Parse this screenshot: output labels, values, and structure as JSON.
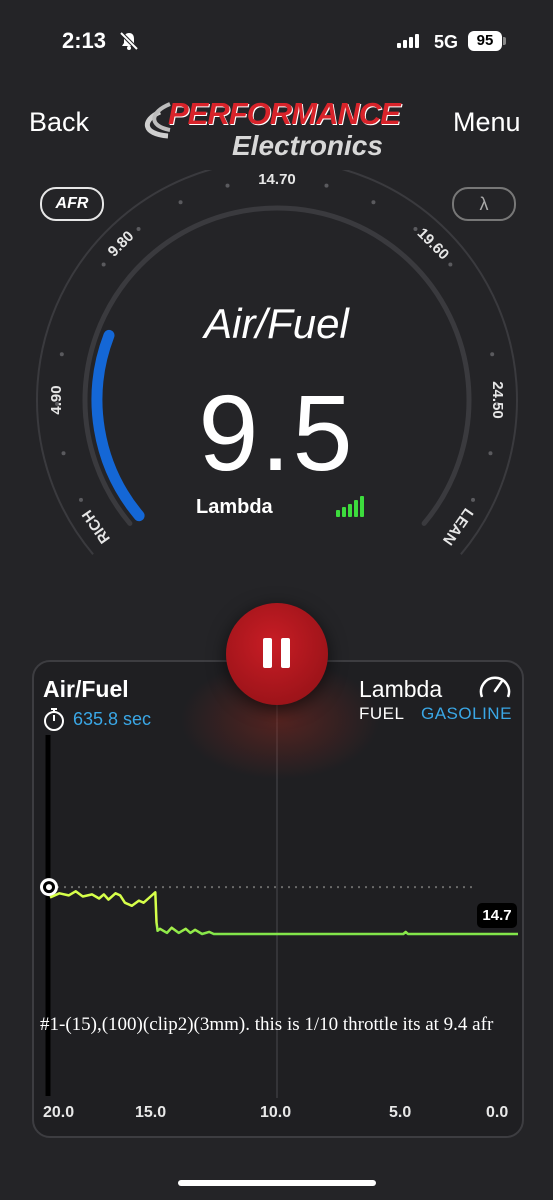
{
  "status": {
    "time": "2:13",
    "network": "5G",
    "battery": "95"
  },
  "nav": {
    "back": "Back",
    "menu": "Menu"
  },
  "logo": {
    "line1": "PERFORMANCE",
    "line2": "Electronics"
  },
  "mode": {
    "afr": "AFR",
    "lambda": "λ"
  },
  "gauge": {
    "title": "Air/Fuel",
    "value": "9.5",
    "unit_label": "Lambda",
    "scale": [
      "4.90",
      "9.80",
      "14.70",
      "19.60",
      "24.50"
    ],
    "rich_label": "RICH",
    "lean_label": "LEAN",
    "level": 9.5,
    "range": [
      4.9,
      24.5
    ],
    "accent": "#1467d6"
  },
  "chart_panel": {
    "title": "Air/Fuel",
    "elapsed": "635.8 sec",
    "lambda_label": "Lambda",
    "fuel_label": "FUEL",
    "fuel_value": "GASOLINE",
    "reference_value": "14.7",
    "note": "#1-(15),(100)(clip2)(3mm). this is 1/10 throttle its at 9.4 afr"
  },
  "chart_data": {
    "type": "line",
    "x_ticks": [
      "20.0",
      "15.0",
      "10.0",
      "5.0",
      "0.0"
    ],
    "xlim": [
      20.0,
      0.0
    ],
    "ylim": [
      8.8,
      16.0
    ],
    "reference_line": 14.7,
    "series": [
      {
        "color": "#1d63c4",
        "x": [
          20.0,
          19.6,
          19.2,
          18.9,
          18.6,
          18.2,
          17.9,
          17.7,
          17.5,
          17.2,
          17.0,
          16.8,
          16.5,
          16.2,
          16.0,
          15.7,
          15.5,
          15.45,
          15.4,
          15.3,
          15.0,
          14.8,
          14.5,
          14.2,
          14.0,
          13.8,
          13.5,
          13.2,
          13.0,
          12.6,
          12.0,
          10.0,
          8.0,
          6.0,
          4.9,
          4.8,
          4.7,
          2.0,
          0.0
        ],
        "y": [
          14.2,
          14.4,
          14.3,
          14.5,
          14.25,
          14.35,
          14.15,
          14.35,
          14.1,
          14.4,
          14.3,
          13.95,
          13.8,
          14.05,
          13.95,
          14.25,
          14.45,
          13.0,
          12.6,
          12.7,
          12.5,
          12.75,
          12.5,
          12.7,
          12.5,
          12.65,
          12.45,
          12.55,
          12.45,
          12.45,
          12.45,
          12.45,
          12.45,
          12.45,
          12.45,
          12.55,
          12.45,
          12.45,
          12.45
        ]
      }
    ]
  }
}
